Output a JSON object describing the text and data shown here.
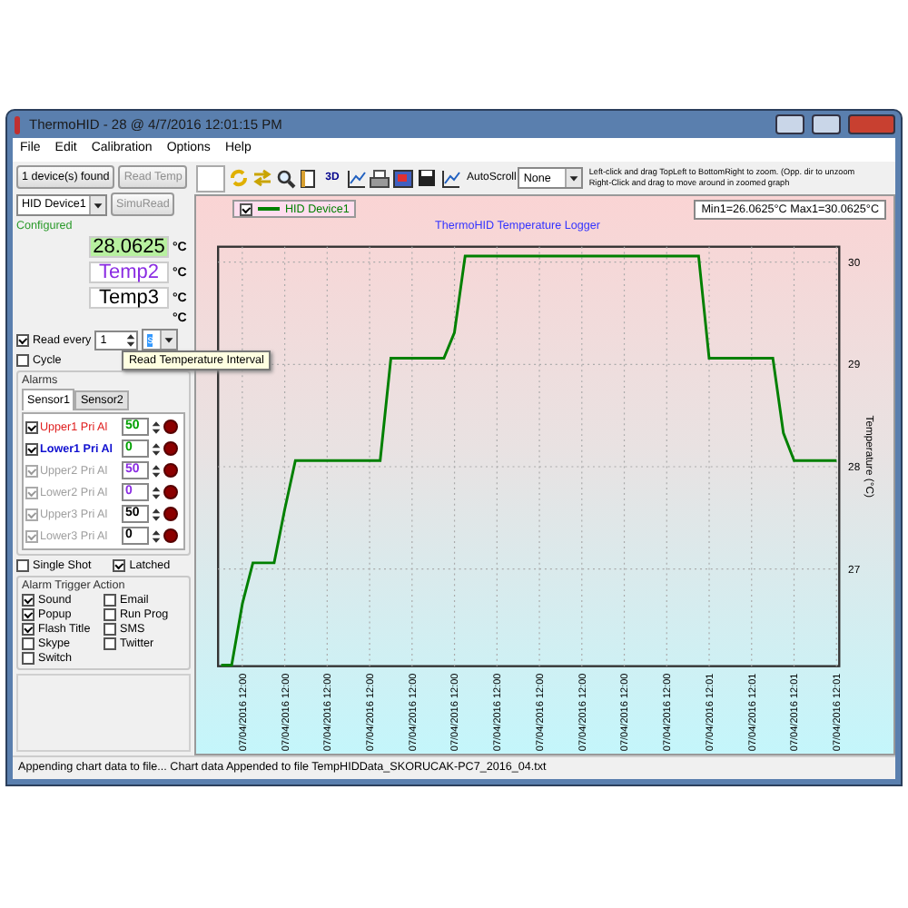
{
  "window": {
    "title": "ThermoHID - 28 @ 4/7/2016 12:01:15 PM"
  },
  "menu": [
    "File",
    "Edit",
    "Calibration",
    "Options",
    "Help"
  ],
  "left": {
    "found_button": "1 device(s) found",
    "read_button": {
      "label": "Read Temp",
      "disabled": true
    },
    "device_select": "HID Device1",
    "simu_button": {
      "label": "SimuRead",
      "disabled": true
    },
    "status": "Configured",
    "readings": [
      {
        "value": "28.0625",
        "unit": "°C",
        "kind": "live"
      },
      {
        "value": "Temp2",
        "unit": "°C",
        "kind": "sensor2"
      },
      {
        "value": "Temp3",
        "unit": "°C",
        "kind": "sensor3"
      }
    ],
    "extra_unit": "°C",
    "read_every": {
      "label": "Read every",
      "checked": true,
      "value": "1",
      "unit": "s",
      "tooltip": "Read Temperature Interval"
    },
    "cycle": {
      "label": "Cycle",
      "checked": false
    },
    "alarms": {
      "title": "Alarms",
      "tabs": [
        {
          "label": "Sensor1",
          "selected": true
        },
        {
          "label": "Sensor2",
          "selected": false
        }
      ],
      "rows": [
        {
          "label": "Upper1 Pri Al",
          "kind": "upper",
          "checked": true,
          "disabled": false,
          "value": "50",
          "color": "#00a000"
        },
        {
          "label": "Lower1 Pri Al",
          "kind": "lower",
          "checked": true,
          "disabled": false,
          "value": "0",
          "color": "#00a000"
        },
        {
          "label": "Upper2 Pri Al",
          "kind": "upper",
          "checked": true,
          "disabled": true,
          "value": "50",
          "color": "#8a2be2"
        },
        {
          "label": "Lower2 Pri Al",
          "kind": "lower",
          "checked": true,
          "disabled": true,
          "value": "0",
          "color": "#8a2be2"
        },
        {
          "label": "Upper3 Pri Al",
          "kind": "upper",
          "checked": true,
          "disabled": true,
          "value": "50",
          "color": "#000000"
        },
        {
          "label": "Lower3 Pri Al",
          "kind": "lower",
          "checked": true,
          "disabled": true,
          "value": "0",
          "color": "#000000"
        }
      ]
    },
    "options": [
      {
        "label": "Single Shot",
        "checked": false
      },
      {
        "label": "Latched",
        "checked": true
      }
    ],
    "actions": {
      "title": "Alarm Trigger Action",
      "items": [
        {
          "label": "Sound",
          "checked": true
        },
        {
          "label": "Email",
          "checked": false
        },
        {
          "label": "Popup",
          "checked": true
        },
        {
          "label": "Run Prog",
          "checked": false
        },
        {
          "label": "Flash Title",
          "checked": true
        },
        {
          "label": "SMS",
          "checked": false
        },
        {
          "label": "Skype",
          "checked": false
        },
        {
          "label": "Twitter",
          "checked": false
        },
        {
          "label": "Switch",
          "checked": false
        }
      ]
    }
  },
  "toolbar": {
    "tools": [
      {
        "kind": "blank"
      },
      {
        "kind": "refresh"
      },
      {
        "kind": "arrows"
      },
      {
        "kind": "zoom"
      },
      {
        "kind": "page"
      },
      {
        "kind": "text",
        "label": "3D"
      },
      {
        "kind": "chart"
      },
      {
        "kind": "printer"
      },
      {
        "kind": "image"
      },
      {
        "kind": "save"
      },
      {
        "kind": "chart"
      }
    ],
    "autoscroll_label": "AutoScroll",
    "autoscroll_value": "None",
    "hint": [
      "Left-click and drag TopLeft to BottomRight to zoom. (Opp. dir to unzoom",
      "Right-Click and drag to move around in  zoomed graph"
    ]
  },
  "chart": {
    "legend": {
      "checked": true
    },
    "minmax": "Min1=26.0625°C Max1=30.0625°C",
    "chart_data": {
      "type": "line",
      "title": "ThermoHID Temperature Logger",
      "ylabel": "Temperature (°C)",
      "grid": true,
      "categories": [
        null,
        null,
        "07/04/2016 12:00",
        null,
        null,
        null,
        "07/04/2016 12:00",
        null,
        null,
        null,
        "07/04/2016 12:00",
        null,
        null,
        null,
        "07/04/2016 12:00",
        null,
        null,
        null,
        "07/04/2016 12:00",
        null,
        null,
        null,
        "07/04/2016 12:00",
        null,
        null,
        null,
        "07/04/2016 12:00",
        null,
        null,
        null,
        "07/04/2016 12:00",
        null,
        null,
        null,
        "07/04/2016 12:00",
        null,
        null,
        null,
        "07/04/2016 12:00",
        null,
        null,
        null,
        "07/04/2016 12:00",
        null,
        null,
        null,
        "07/04/2016 12:01",
        null,
        null,
        null,
        "07/04/2016 12:01",
        null,
        null,
        null,
        "07/04/2016 12:01",
        null,
        null,
        null,
        "07/04/2016 12:01"
      ],
      "series": [
        {
          "name": "HID Device1",
          "color": "#008000",
          "values": [
            26.06,
            26.06,
            26.66,
            27.06,
            27.06,
            27.06,
            27.58,
            28.06,
            28.06,
            28.06,
            28.06,
            28.06,
            28.06,
            28.06,
            28.06,
            28.06,
            29.06,
            29.06,
            29.06,
            29.06,
            29.06,
            29.06,
            29.31,
            30.06,
            30.06,
            30.06,
            30.06,
            30.06,
            30.06,
            30.06,
            30.06,
            30.06,
            30.06,
            30.06,
            30.06,
            30.06,
            30.06,
            30.06,
            30.06,
            30.06,
            30.06,
            30.06,
            30.06,
            30.06,
            30.06,
            30.06,
            29.06,
            29.06,
            29.06,
            29.06,
            29.06,
            29.06,
            29.06,
            28.33,
            28.06,
            28.06,
            28.06,
            28.06,
            28.06
          ]
        }
      ],
      "ylim": [
        26.05,
        30.15
      ],
      "yticks": [
        27,
        28,
        29,
        30
      ]
    }
  },
  "status_bar": "Appending chart data to file... Chart data Appended to file TempHIDData_SKORUCAK-PC7_2016_04.txt"
}
